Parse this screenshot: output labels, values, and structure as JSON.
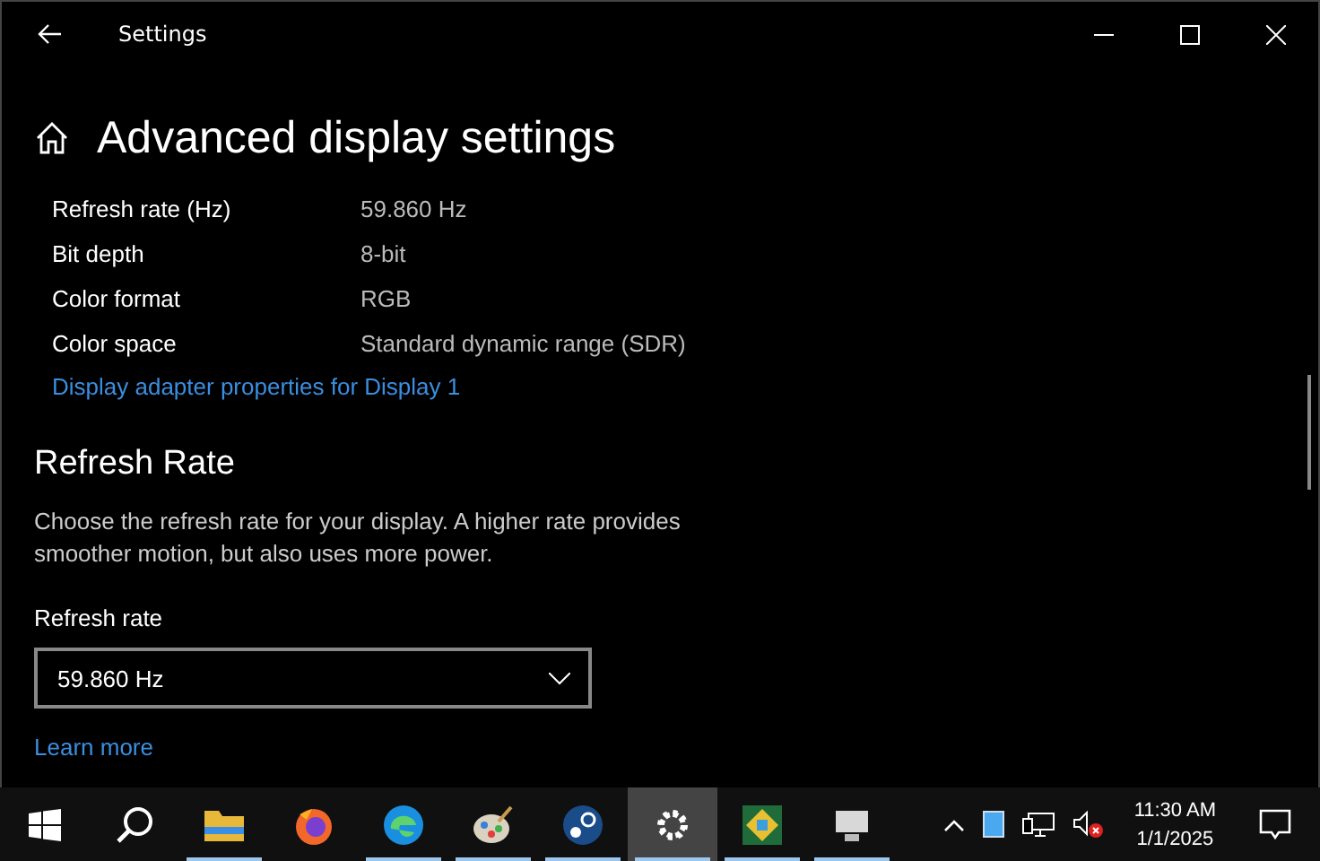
{
  "window": {
    "title": "Settings"
  },
  "header": {
    "title": "Advanced display settings"
  },
  "info_rows": [
    {
      "label": "Refresh rate (Hz)",
      "value": "59.860 Hz"
    },
    {
      "label": "Bit depth",
      "value": "8-bit"
    },
    {
      "label": "Color format",
      "value": "RGB"
    },
    {
      "label": "Color space",
      "value": "Standard dynamic range (SDR)"
    }
  ],
  "adapter_link": "Display adapter properties for Display 1",
  "refresh_section": {
    "title": "Refresh Rate",
    "description": "Choose the refresh rate for your display. A higher rate provides smoother motion, but also uses more power.",
    "dropdown_label": "Refresh rate",
    "dropdown_value": "59.860 Hz",
    "learn_more": "Learn more"
  },
  "taskbar": {
    "apps": [
      {
        "running": true,
        "selected": false
      },
      {
        "running": false,
        "selected": false
      },
      {
        "running": true,
        "selected": false
      },
      {
        "running": true,
        "selected": false
      },
      {
        "running": true,
        "selected": false
      },
      {
        "running": true,
        "selected": true
      },
      {
        "running": true,
        "selected": false
      },
      {
        "running": true,
        "selected": false
      }
    ],
    "time": "11:30 AM",
    "date": "1/1/2025"
  }
}
